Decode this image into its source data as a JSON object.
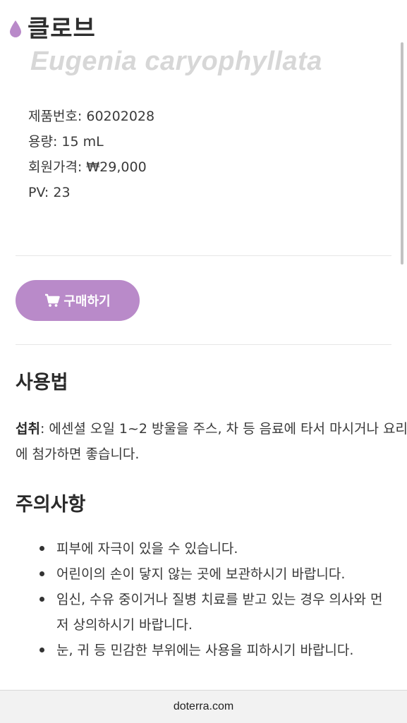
{
  "product": {
    "title": "클로브",
    "latin_name": "Eugenia caryophyllata",
    "info": [
      {
        "label": "제품번호:",
        "value": "60202028"
      },
      {
        "label": "용량:",
        "value": "15 mL"
      },
      {
        "label": "회원가격:",
        "currency": "₩",
        "value": "29,000"
      },
      {
        "label": "PV:",
        "value": "23"
      }
    ],
    "buy_label": "구매하기",
    "accent_color": "#b98ac9"
  },
  "usage": {
    "heading": "사용법",
    "method_label": "섭취",
    "method_text": ": 에센셜 오일 1~2 방울을 주스, 차 등 음료에 타서 마시거나 요리에 첨가하면 좋습니다."
  },
  "warnings": {
    "heading": "주의사항",
    "items": [
      "피부에 자극이 있을 수 있습니다.",
      "어린이의 손이 닿지 않는 곳에 보관하시기 바랍니다.",
      "임신, 수유 중이거나 질병 치료를 받고 있는 경우 의사와 먼저 상의하시기 바랍니다.",
      "눈, 귀 등 민감한 부위에는 사용을 피하시기 바랍니다."
    ]
  },
  "browser": {
    "url": "doterra.com"
  },
  "icons": {
    "title": "drop-icon",
    "buy": "cart-icon"
  }
}
